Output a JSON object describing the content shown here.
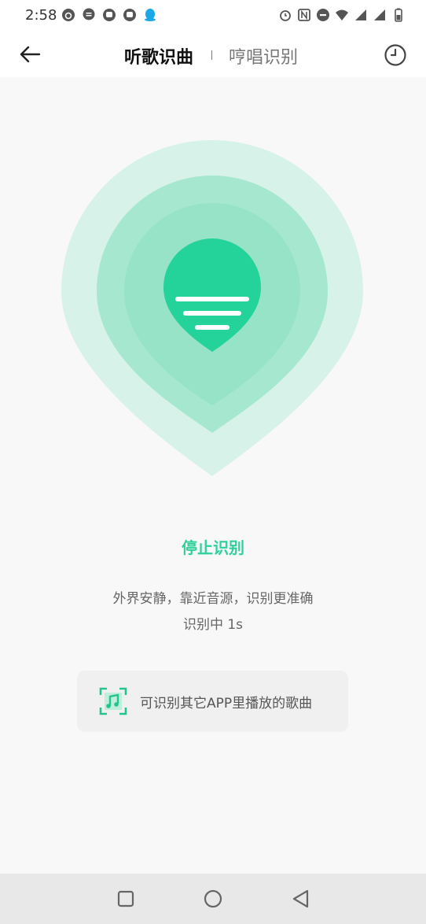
{
  "status_bar": {
    "time": "2:58"
  },
  "header": {
    "tabs": [
      {
        "label": "听歌识曲",
        "active": true
      },
      {
        "label": "哼唱识别",
        "active": false
      }
    ]
  },
  "recognition": {
    "stop_label": "停止识别",
    "hint": "外界安静，靠近音源，识别更准确",
    "status": "识别中 1s"
  },
  "other_app": {
    "label": "可识别其它APP里播放的歌曲"
  },
  "colors": {
    "accent": "#2fd19b"
  },
  "icons": {
    "back": "arrow-left-icon",
    "history": "clock-icon",
    "music_scan": "music-scan-icon"
  }
}
